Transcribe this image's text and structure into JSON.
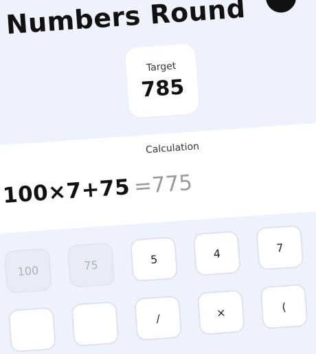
{
  "header": {
    "title": "Numbers Round"
  },
  "target": {
    "label": "Target",
    "value": "785"
  },
  "calculation": {
    "label": "Calculation",
    "expression": "100×7+75",
    "result": "=775"
  },
  "number_tiles": [
    {
      "label": "100",
      "state": "used"
    },
    {
      "label": "75",
      "state": "used"
    },
    {
      "label": "5",
      "state": "available"
    },
    {
      "label": "4",
      "state": "available"
    },
    {
      "label": "7",
      "state": "available"
    }
  ],
  "operator_tiles": [
    {
      "label": "",
      "state": "available"
    },
    {
      "label": "",
      "state": "available"
    },
    {
      "label": "/",
      "state": "available"
    },
    {
      "label": "×",
      "state": "available"
    },
    {
      "label": "(",
      "state": "available"
    }
  ],
  "colors": {
    "background": "#eef2fb",
    "card": "#ffffff",
    "tile_border": "#dde2ee",
    "used_tile": "#e8ecf5",
    "text": "#111111",
    "muted": "#9a9a9a"
  }
}
